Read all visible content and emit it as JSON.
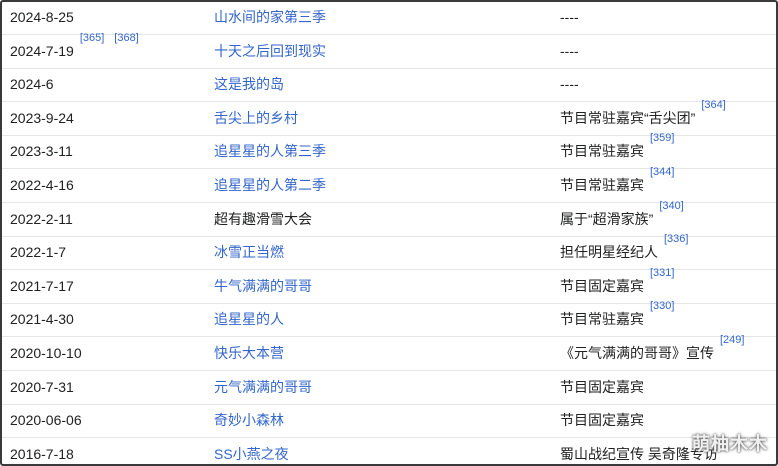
{
  "rows": [
    {
      "date": "2024-8-25",
      "date_refs": [],
      "show": "山水间的家第三季",
      "show_link": true,
      "note": "----",
      "note_refs": []
    },
    {
      "date": "2024-7-19",
      "date_refs": [
        "[365]",
        "[368]"
      ],
      "show": "十天之后回到现实",
      "show_link": true,
      "note": "----",
      "note_refs": []
    },
    {
      "date": "2024-6",
      "date_refs": [],
      "show": "这是我的岛",
      "show_link": true,
      "note": "----",
      "note_refs": []
    },
    {
      "date": "2023-9-24",
      "date_refs": [],
      "show": "舌尖上的乡村",
      "show_link": true,
      "note": "节目常驻嘉宾“舌尖团”",
      "note_refs": [
        "[364]"
      ]
    },
    {
      "date": "2023-3-11",
      "date_refs": [],
      "show": "追星星的人第三季",
      "show_link": true,
      "note": "节目常驻嘉宾",
      "note_refs": [
        "[359]"
      ]
    },
    {
      "date": "2022-4-16",
      "date_refs": [],
      "show": "追星星的人第二季",
      "show_link": true,
      "note": "节目常驻嘉宾",
      "note_refs": [
        "[344]"
      ]
    },
    {
      "date": "2022-2-11",
      "date_refs": [],
      "show": "超有趣滑雪大会",
      "show_link": false,
      "note": "属于“超滑家族”",
      "note_refs": [
        "[340]"
      ]
    },
    {
      "date": "2022-1-7",
      "date_refs": [],
      "show": "冰雪正当燃",
      "show_link": true,
      "note": "担任明星经纪人",
      "note_refs": [
        "[336]"
      ]
    },
    {
      "date": "2021-7-17",
      "date_refs": [],
      "show": "牛气满满的哥哥",
      "show_link": true,
      "note": "节目固定嘉宾",
      "note_refs": [
        "[331]"
      ]
    },
    {
      "date": "2021-4-30",
      "date_refs": [],
      "show": "追星星的人",
      "show_link": true,
      "note": "节目常驻嘉宾",
      "note_refs": [
        "[330]"
      ]
    },
    {
      "date": "2020-10-10",
      "date_refs": [],
      "show": "快乐大本营",
      "show_link": true,
      "note": "《元气满满的哥哥》宣传",
      "note_refs": [
        "[249]"
      ]
    },
    {
      "date": "2020-7-31",
      "date_refs": [],
      "show": "元气满满的哥哥",
      "show_link": true,
      "note": "节目固定嘉宾",
      "note_refs": []
    },
    {
      "date": "2020-06-06",
      "date_refs": [],
      "show": "奇妙小森林",
      "show_link": true,
      "note": "节目固定嘉宾",
      "note_refs": []
    },
    {
      "date": "2016-7-18",
      "date_refs": [],
      "show": "SS小燕之夜",
      "show_link": true,
      "note": "蜀山战纪宣传 吴奇隆专访",
      "note_refs": []
    }
  ],
  "watermark": "萌柚木木",
  "colors": {
    "link": "#3366cc",
    "text": "#202122",
    "border": "#3a3a3a",
    "divider": "#e6e6e6"
  }
}
